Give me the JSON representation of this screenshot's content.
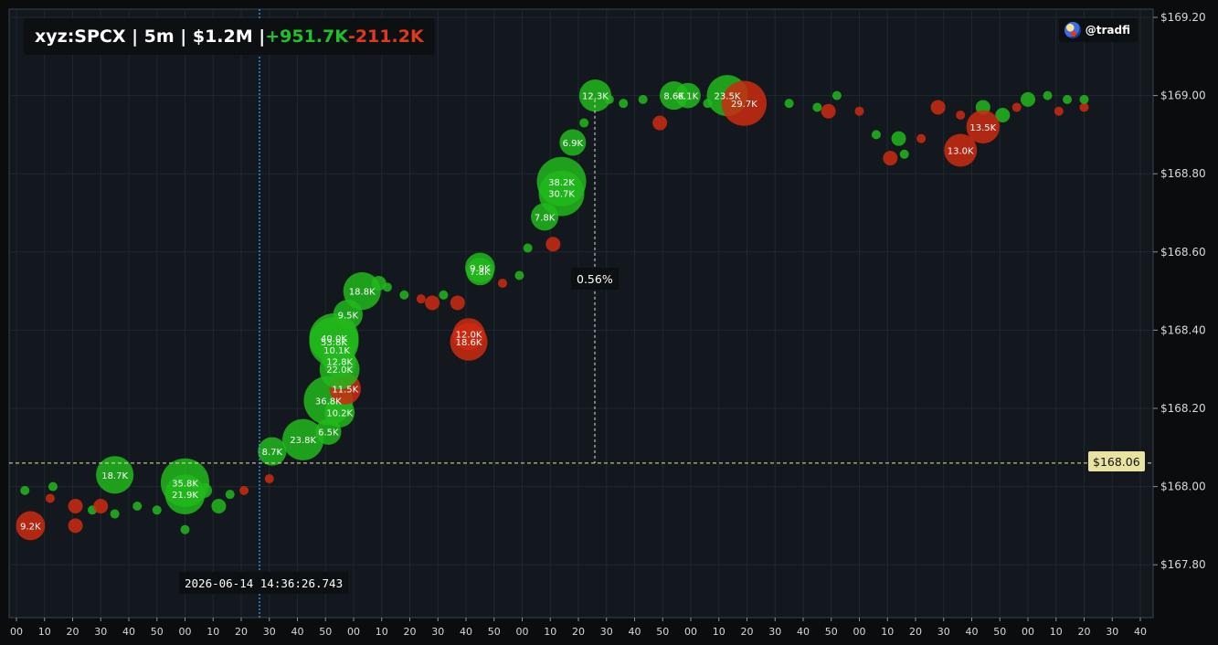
{
  "header": {
    "prefix": "xyz:SPCX | 5m | $1.2M | ",
    "buy_total": "+951.7K",
    "sell_total": "-211.2K"
  },
  "brand": {
    "handle": "@tradfi",
    "icon": "avatar-icon"
  },
  "crosshair": {
    "time_label": "2026-06-14 14:36:26.743",
    "price_label": "$168.06",
    "change_label": "0.56%"
  },
  "colors": {
    "buy": "#22b81c",
    "sell": "#cc2a10",
    "background": "#12181d",
    "grid": "#1f2830",
    "crosshair": "#e8e3a0"
  },
  "chart_data": {
    "type": "scatter",
    "title": "xyz:SPCX | 5m | $1.2M | +951.7K-211.2K",
    "y_ticks": [
      "$169.20",
      "$169.00",
      "$168.80",
      "$168.60",
      "$168.40",
      "$168.20",
      "$168.00",
      "$167.80"
    ],
    "x_ticks": [
      "00",
      "10",
      "20",
      "30",
      "40",
      "50",
      "00",
      "10",
      "20",
      "30",
      "40",
      "50",
      "00",
      "10",
      "20",
      "30",
      "40",
      "50",
      "00",
      "10",
      "20",
      "30",
      "40",
      "50",
      "00",
      "10",
      "20",
      "30",
      "40",
      "50",
      "00",
      "10",
      "20",
      "30",
      "40",
      "50",
      "00",
      "10",
      "20",
      "30",
      "40"
    ],
    "ylim": [
      167.65,
      169.24
    ],
    "trades_labeled": [
      {
        "t": 0.5,
        "price": 167.9,
        "side": "sell",
        "size": "9.2K"
      },
      {
        "t": 3.5,
        "price": 168.03,
        "side": "buy",
        "size": "18.7K"
      },
      {
        "t": 6.0,
        "price": 168.01,
        "side": "buy",
        "size": "35.8K"
      },
      {
        "t": 6.0,
        "price": 167.98,
        "side": "buy",
        "size": "21.9K"
      },
      {
        "t": 9.1,
        "price": 168.09,
        "side": "buy",
        "size": "8.7K"
      },
      {
        "t": 10.2,
        "price": 168.12,
        "side": "buy",
        "size": "23.8K"
      },
      {
        "t": 11.1,
        "price": 168.14,
        "side": "buy",
        "size": "6.5K"
      },
      {
        "t": 11.1,
        "price": 168.22,
        "side": "buy",
        "size": "36.8K"
      },
      {
        "t": 11.5,
        "price": 168.19,
        "side": "buy",
        "size": "10.2K"
      },
      {
        "t": 11.7,
        "price": 168.25,
        "side": "sell",
        "size": "11.5K"
      },
      {
        "t": 11.5,
        "price": 168.3,
        "side": "buy",
        "size": "22.0K"
      },
      {
        "t": 11.5,
        "price": 168.32,
        "side": "buy",
        "size": "12.8K"
      },
      {
        "t": 11.3,
        "price": 168.38,
        "side": "buy",
        "size": "40.0K"
      },
      {
        "t": 11.3,
        "price": 168.37,
        "side": "buy",
        "size": "53.8K"
      },
      {
        "t": 11.4,
        "price": 168.35,
        "side": "buy",
        "size": "10.1K"
      },
      {
        "t": 11.8,
        "price": 168.44,
        "side": "buy",
        "size": "9.5K"
      },
      {
        "t": 12.3,
        "price": 168.5,
        "side": "buy",
        "size": "18.8K"
      },
      {
        "t": 16.1,
        "price": 168.37,
        "side": "sell",
        "size": "18.6K"
      },
      {
        "t": 16.1,
        "price": 168.39,
        "side": "sell",
        "size": "12.0K"
      },
      {
        "t": 16.5,
        "price": 168.56,
        "side": "buy",
        "size": "9.9K"
      },
      {
        "t": 16.5,
        "price": 168.55,
        "side": "buy",
        "size": "7.8K"
      },
      {
        "t": 18.8,
        "price": 168.69,
        "side": "buy",
        "size": "7.8K"
      },
      {
        "t": 19.4,
        "price": 168.78,
        "side": "buy",
        "size": "38.2K"
      },
      {
        "t": 19.4,
        "price": 168.75,
        "side": "buy",
        "size": "30.7K"
      },
      {
        "t": 19.8,
        "price": 168.88,
        "side": "buy",
        "size": "6.9K"
      },
      {
        "t": 20.6,
        "price": 169.0,
        "side": "buy",
        "size": "12.3K"
      },
      {
        "t": 23.4,
        "price": 169.0,
        "side": "buy",
        "size": "8.6K"
      },
      {
        "t": 23.9,
        "price": 169.0,
        "side": "buy",
        "size": "6.1K"
      },
      {
        "t": 25.3,
        "price": 169.0,
        "side": "buy",
        "size": "23.5K"
      },
      {
        "t": 25.9,
        "price": 168.98,
        "side": "sell",
        "size": "29.7K"
      },
      {
        "t": 33.6,
        "price": 168.86,
        "side": "sell",
        "size": "13.0K"
      },
      {
        "t": 34.4,
        "price": 168.92,
        "side": "sell",
        "size": "13.5K"
      }
    ],
    "trades_unlabeled": [
      {
        "t": 0.3,
        "price": 167.99,
        "side": "buy",
        "size": "s"
      },
      {
        "t": 1.2,
        "price": 167.97,
        "side": "sell",
        "size": "s"
      },
      {
        "t": 1.3,
        "price": 168.0,
        "side": "buy",
        "size": "s"
      },
      {
        "t": 2.1,
        "price": 167.95,
        "side": "sell",
        "size": "m"
      },
      {
        "t": 2.1,
        "price": 167.9,
        "side": "sell",
        "size": "m"
      },
      {
        "t": 2.7,
        "price": 167.94,
        "side": "buy",
        "size": "s"
      },
      {
        "t": 3.0,
        "price": 167.95,
        "side": "sell",
        "size": "m"
      },
      {
        "t": 3.5,
        "price": 167.93,
        "side": "buy",
        "size": "s"
      },
      {
        "t": 4.3,
        "price": 167.95,
        "side": "buy",
        "size": "s"
      },
      {
        "t": 5.0,
        "price": 167.94,
        "side": "buy",
        "size": "s"
      },
      {
        "t": 6.0,
        "price": 167.89,
        "side": "buy",
        "size": "s"
      },
      {
        "t": 6.7,
        "price": 167.99,
        "side": "buy",
        "size": "m"
      },
      {
        "t": 7.2,
        "price": 167.95,
        "side": "buy",
        "size": "m"
      },
      {
        "t": 7.6,
        "price": 167.98,
        "side": "buy",
        "size": "s"
      },
      {
        "t": 8.1,
        "price": 167.99,
        "side": "sell",
        "size": "s"
      },
      {
        "t": 9.0,
        "price": 168.02,
        "side": "sell",
        "size": "s"
      },
      {
        "t": 12.9,
        "price": 168.52,
        "side": "buy",
        "size": "m"
      },
      {
        "t": 13.2,
        "price": 168.51,
        "side": "buy",
        "size": "s"
      },
      {
        "t": 13.8,
        "price": 168.49,
        "side": "buy",
        "size": "s"
      },
      {
        "t": 14.4,
        "price": 168.48,
        "side": "sell",
        "size": "s"
      },
      {
        "t": 14.8,
        "price": 168.47,
        "side": "sell",
        "size": "m"
      },
      {
        "t": 15.2,
        "price": 168.49,
        "side": "buy",
        "size": "s"
      },
      {
        "t": 15.7,
        "price": 168.47,
        "side": "sell",
        "size": "m"
      },
      {
        "t": 17.3,
        "price": 168.52,
        "side": "sell",
        "size": "s"
      },
      {
        "t": 17.9,
        "price": 168.54,
        "side": "buy",
        "size": "s"
      },
      {
        "t": 18.2,
        "price": 168.61,
        "side": "buy",
        "size": "s"
      },
      {
        "t": 19.1,
        "price": 168.62,
        "side": "sell",
        "size": "m"
      },
      {
        "t": 20.2,
        "price": 168.93,
        "side": "buy",
        "size": "s"
      },
      {
        "t": 21.1,
        "price": 168.99,
        "side": "buy",
        "size": "s"
      },
      {
        "t": 21.6,
        "price": 168.98,
        "side": "buy",
        "size": "s"
      },
      {
        "t": 22.3,
        "price": 168.99,
        "side": "buy",
        "size": "s"
      },
      {
        "t": 22.9,
        "price": 168.93,
        "side": "sell",
        "size": "m"
      },
      {
        "t": 24.6,
        "price": 168.98,
        "side": "buy",
        "size": "s"
      },
      {
        "t": 27.5,
        "price": 168.98,
        "side": "buy",
        "size": "s"
      },
      {
        "t": 28.5,
        "price": 168.97,
        "side": "buy",
        "size": "s"
      },
      {
        "t": 28.9,
        "price": 168.96,
        "side": "sell",
        "size": "m"
      },
      {
        "t": 29.2,
        "price": 169.0,
        "side": "buy",
        "size": "s"
      },
      {
        "t": 30.0,
        "price": 168.96,
        "side": "sell",
        "size": "s"
      },
      {
        "t": 30.6,
        "price": 168.9,
        "side": "buy",
        "size": "s"
      },
      {
        "t": 31.1,
        "price": 168.84,
        "side": "sell",
        "size": "m"
      },
      {
        "t": 31.4,
        "price": 168.89,
        "side": "buy",
        "size": "m"
      },
      {
        "t": 31.6,
        "price": 168.85,
        "side": "buy",
        "size": "s"
      },
      {
        "t": 32.2,
        "price": 168.89,
        "side": "sell",
        "size": "s"
      },
      {
        "t": 32.8,
        "price": 168.97,
        "side": "sell",
        "size": "m"
      },
      {
        "t": 33.6,
        "price": 168.95,
        "side": "sell",
        "size": "s"
      },
      {
        "t": 34.4,
        "price": 168.97,
        "side": "buy",
        "size": "m"
      },
      {
        "t": 35.1,
        "price": 168.95,
        "side": "buy",
        "size": "m"
      },
      {
        "t": 35.6,
        "price": 168.97,
        "side": "sell",
        "size": "s"
      },
      {
        "t": 36.0,
        "price": 168.99,
        "side": "buy",
        "size": "m"
      },
      {
        "t": 36.7,
        "price": 169.0,
        "side": "buy",
        "size": "s"
      },
      {
        "t": 37.1,
        "price": 168.96,
        "side": "sell",
        "size": "s"
      },
      {
        "t": 37.4,
        "price": 168.99,
        "side": "buy",
        "size": "s"
      },
      {
        "t": 38.0,
        "price": 168.97,
        "side": "sell",
        "size": "s"
      },
      {
        "t": 38.0,
        "price": 168.99,
        "side": "buy",
        "size": "s"
      }
    ]
  }
}
